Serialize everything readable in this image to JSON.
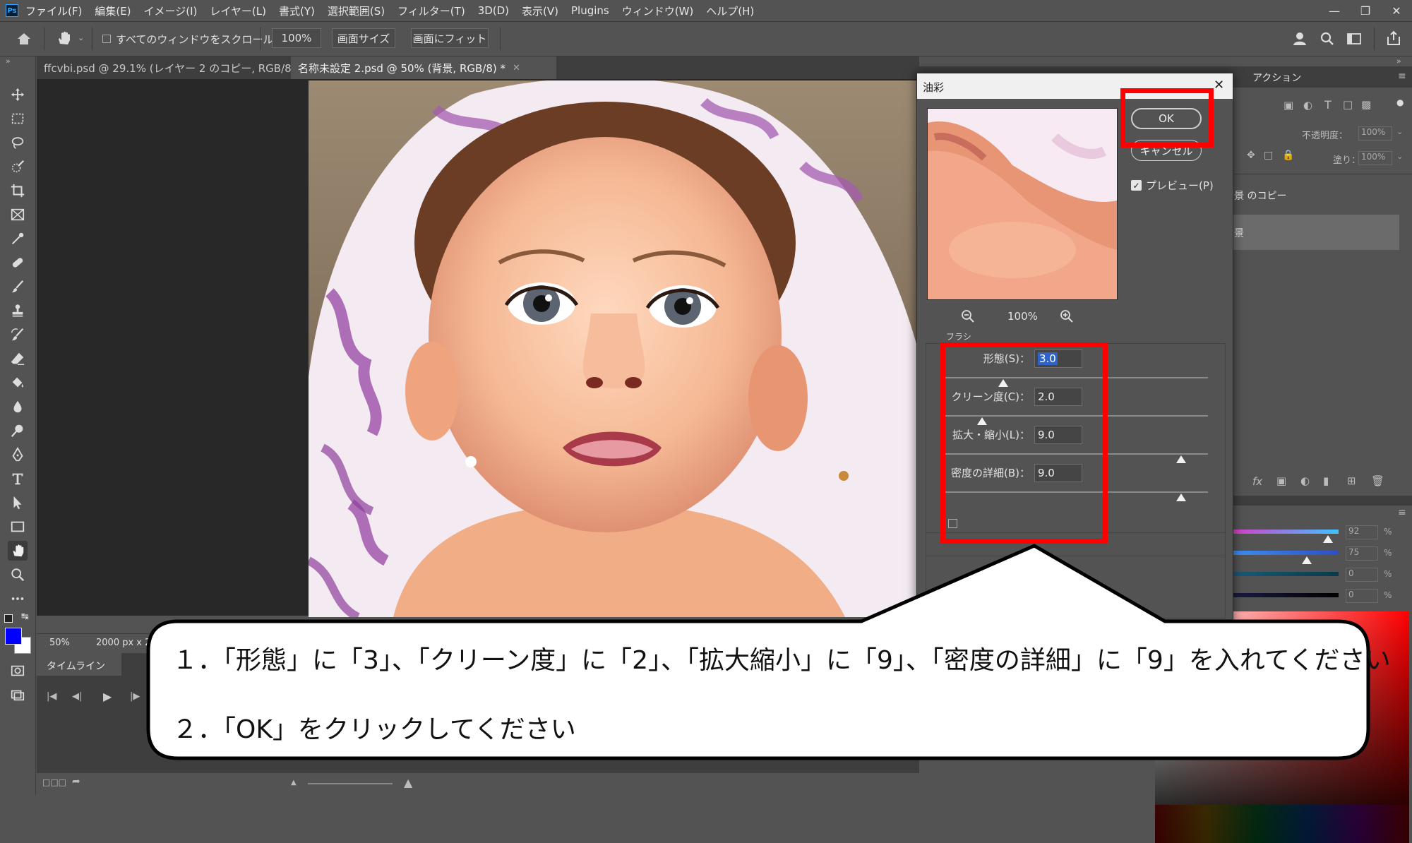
{
  "app": {
    "logo": "Ps"
  },
  "menu": [
    "ファイル(F)",
    "編集(E)",
    "イメージ(I)",
    "レイヤー(L)",
    "書式(Y)",
    "選択範囲(S)",
    "フィルター(T)",
    "3D(D)",
    "表示(V)",
    "Plugins",
    "ウィンドウ(W)",
    "ヘルプ(H)"
  ],
  "options_bar": {
    "scroll_all_windows_label": "すべてのウィンドウをスクロール",
    "zoom_value": "100%",
    "fit_screen_label": "画面サイズ",
    "fill_screen_label": "画面にフィット"
  },
  "tabs": [
    {
      "label": "ffcvbi.psd @ 29.1% (レイヤー 2 のコピー, RGB/8) *",
      "active": false
    },
    {
      "label": "名称未設定 2.psd @ 50% (背景, RGB/8) *",
      "active": true
    }
  ],
  "status_bar": {
    "zoom": "50%",
    "doc_size": "2000 px x 2"
  },
  "timeline": {
    "label": "タイムライン"
  },
  "right_panel": {
    "actions_tab": "アクション",
    "opacity_label": "不透明度：",
    "opacity_value": "100%",
    "fill_label": "塗り：",
    "fill_value": "100%",
    "layer_copy_label": "景 のコピー",
    "layer_bg_label": "景",
    "color_values": [
      "92",
      "75",
      "0",
      "0"
    ],
    "percent": "%"
  },
  "dialog": {
    "title": "油彩",
    "ok_label": "OK",
    "cancel_label": "キャンセル",
    "preview_label": "プレビュー(P)",
    "preview_checked": true,
    "zoom_value": "100%",
    "section_label": "ブラシ",
    "params": [
      {
        "label": "形態(S)：",
        "value": "3.0",
        "fraction": 0.23
      },
      {
        "label": "クリーン度(C)：",
        "value": "2.0",
        "fraction": 0.15
      },
      {
        "label": "拡大・縮小(L)：",
        "value": "9.0",
        "fraction": 0.9
      },
      {
        "label": "密度の詳細(B)：",
        "value": "9.0",
        "fraction": 0.9
      }
    ]
  },
  "callout": {
    "line1": "１．「形態」に「3」、「クリーン度」に「2」、「拡大縮小」に「9」、「密度の詳細」に「9」を入れてください",
    "line2": "２．「OK」をクリックしてください"
  },
  "colors": {
    "highlight": "#ff0000",
    "foreground_color": "#0000ff",
    "background_color": "#ffffff"
  }
}
